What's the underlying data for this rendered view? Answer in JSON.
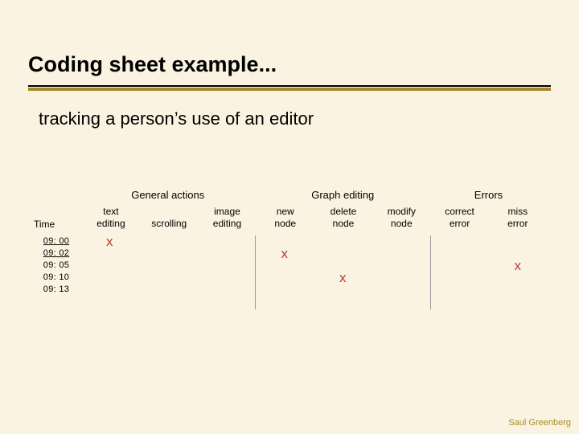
{
  "title": "Coding sheet example...",
  "subtitle": "tracking a person’s use of an editor",
  "group_headers": {
    "general": "General actions",
    "graph": "Graph editing",
    "errors": "Errors"
  },
  "columns": {
    "time": "Time",
    "text_editing_l1": "text",
    "text_editing_l2": "editing",
    "scrolling": "scrolling",
    "image_editing_l1": "image",
    "image_editing_l2": "editing",
    "new_node_l1": "new",
    "new_node_l2": "node",
    "delete_node_l1": "delete",
    "delete_node_l2": "node",
    "modify_node_l1": "modify",
    "modify_node_l2": "node",
    "correct_error_l1": "correct",
    "correct_error_l2": "error",
    "miss_error_l1": "miss",
    "miss_error_l2": "error"
  },
  "rows": [
    {
      "time": "09: 00",
      "underlined": true,
      "marks": {
        "text_editing": "x",
        "scrolling": "",
        "image_editing": "",
        "new_node": "",
        "delete_node": "",
        "modify_node": "",
        "correct_error": "",
        "miss_error": ""
      }
    },
    {
      "time": "09: 02",
      "underlined": true,
      "marks": {
        "text_editing": "",
        "scrolling": "",
        "image_editing": "",
        "new_node": "x",
        "delete_node": "",
        "modify_node": "",
        "correct_error": "",
        "miss_error": ""
      }
    },
    {
      "time": "09: 05",
      "underlined": false,
      "marks": {
        "text_editing": "",
        "scrolling": "",
        "image_editing": "",
        "new_node": "",
        "delete_node": "",
        "modify_node": "",
        "correct_error": "",
        "miss_error": "x"
      }
    },
    {
      "time": "09: 10",
      "underlined": false,
      "marks": {
        "text_editing": "",
        "scrolling": "",
        "image_editing": "",
        "new_node": "",
        "delete_node": "x",
        "modify_node": "",
        "correct_error": "",
        "miss_error": ""
      }
    },
    {
      "time": "09: 13",
      "underlined": false,
      "marks": {
        "text_editing": "",
        "scrolling": "",
        "image_editing": "",
        "new_node": "",
        "delete_node": "",
        "modify_node": "",
        "correct_error": "",
        "miss_error": ""
      }
    }
  ],
  "footer": "Saul Greenberg",
  "chart_data": {
    "type": "table",
    "title": "Coding sheet example",
    "column_groups": [
      {
        "name": "General actions",
        "columns": [
          "text editing",
          "scrolling",
          "image editing"
        ]
      },
      {
        "name": "Graph editing",
        "columns": [
          "new node",
          "delete node",
          "modify node"
        ]
      },
      {
        "name": "Errors",
        "columns": [
          "correct error",
          "miss error"
        ]
      }
    ],
    "rows": [
      {
        "Time": "09:00",
        "text editing": 1,
        "scrolling": 0,
        "image editing": 0,
        "new node": 0,
        "delete node": 0,
        "modify node": 0,
        "correct error": 0,
        "miss error": 0
      },
      {
        "Time": "09:02",
        "text editing": 0,
        "scrolling": 0,
        "image editing": 0,
        "new node": 1,
        "delete node": 0,
        "modify node": 0,
        "correct error": 0,
        "miss error": 0
      },
      {
        "Time": "09:05",
        "text editing": 0,
        "scrolling": 0,
        "image editing": 0,
        "new node": 0,
        "delete node": 0,
        "modify node": 0,
        "correct error": 0,
        "miss error": 1
      },
      {
        "Time": "09:10",
        "text editing": 0,
        "scrolling": 0,
        "image editing": 0,
        "new node": 0,
        "delete node": 1,
        "modify node": 0,
        "correct error": 0,
        "miss error": 0
      },
      {
        "Time": "09:13",
        "text editing": 0,
        "scrolling": 0,
        "image editing": 0,
        "new node": 0,
        "delete node": 0,
        "modify node": 0,
        "correct error": 0,
        "miss error": 0
      }
    ]
  }
}
